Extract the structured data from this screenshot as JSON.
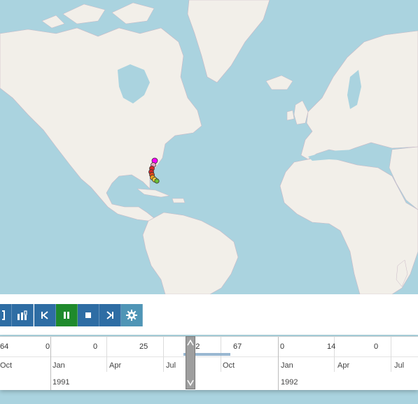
{
  "toolbar": {
    "buttons": [
      {
        "icon": "bracket-icon"
      },
      {
        "icon": "data-layers-icon"
      },
      {
        "icon": "skip-back-icon"
      },
      {
        "icon": "pause-icon"
      },
      {
        "icon": "stop-icon"
      },
      {
        "icon": "skip-forward-icon"
      },
      {
        "icon": "gear-icon"
      }
    ]
  },
  "timeline": {
    "counts": [
      "64",
      "0",
      "0",
      "25",
      "132",
      "67",
      "0",
      "14",
      "0"
    ],
    "months": [
      "Oct",
      "Jan",
      "Apr",
      "Jul",
      "Oct",
      "Jan",
      "Apr",
      "Jul"
    ],
    "years": [
      "1991",
      "1992"
    ]
  },
  "colors": {
    "water": "#aad3df",
    "land": "#f2efe9",
    "button_blue": "#2e6da4",
    "button_green": "#1f8a2c",
    "button_gear": "#4f95b6",
    "track_start": "#ff00ff",
    "track_mid": "#d62828",
    "track_end": "#6bbf3a"
  }
}
